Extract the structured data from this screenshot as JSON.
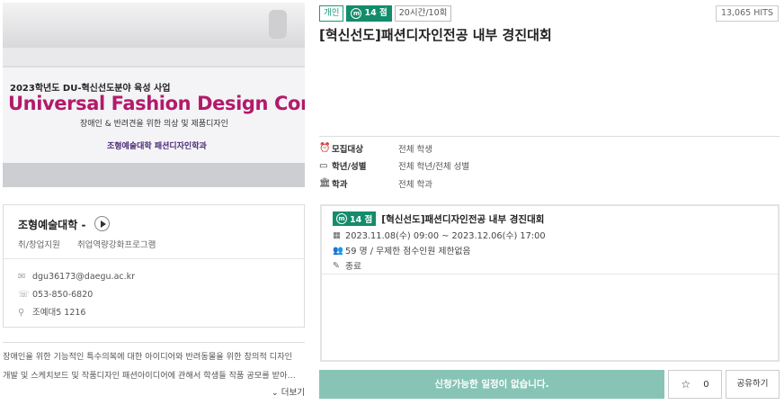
{
  "banner": {
    "line1": "2023학년도 DU-혁신선도분야 육성 사업",
    "line2": "Universal Fashion Design Contest",
    "line3": "장애인 & 반려견을 위한 의상 및 제품디자인",
    "line4": "조형예술대학 패션디자인학과"
  },
  "org": {
    "name": "조형예술대학",
    "dash": "-",
    "category1": "취/창업지원",
    "category2": "취업역량강화프로그램",
    "email": "dgu36173@daegu.ac.kr",
    "phone": "053-850-6820",
    "location": "조예대5 1216"
  },
  "description": {
    "line1": "장애인을 위한 기능적인 특수의복에 대한 아이디어와 반려동물을 위한 창의적 디자인",
    "line2": "개발 및 스케치보드 및 작품디자인 패션아이디어에 관해서 학생들 작품 공모를 받아…",
    "more": "더보기"
  },
  "tags": {
    "type": "개인",
    "points": "14 점",
    "coin": "m",
    "duration": "20시간/10회"
  },
  "hits": "13,065 HITS",
  "title": "[혁신선도]패션디자인전공 내부 경진대회",
  "info": [
    {
      "icon": "alarm-icon",
      "label": "모집대상",
      "value": "전체 학생"
    },
    {
      "icon": "calendar-icon",
      "label": "학년/성별",
      "value": "전체 학년/전체 성별"
    },
    {
      "icon": "building-icon",
      "label": "학과",
      "value": "전체 학과"
    }
  ],
  "schedule": {
    "points": "14 점",
    "coin": "m",
    "title": "[혁신선도]패션디자인전공 내부 경진대회",
    "period": "2023.11.08(수) 09:00 ~ 2023.12.06(수) 17:00",
    "capacity": "59 명 / 무제한 점수인원 제한없음",
    "status": "종료"
  },
  "buttons": {
    "apply": "신청가능한 일정이 없습니다.",
    "favorite_count": "0",
    "share": "공유하기"
  },
  "colors": {
    "green": "#138c6b",
    "apply_bg": "#87c4b5",
    "banner_magenta": "#b21a6a"
  }
}
